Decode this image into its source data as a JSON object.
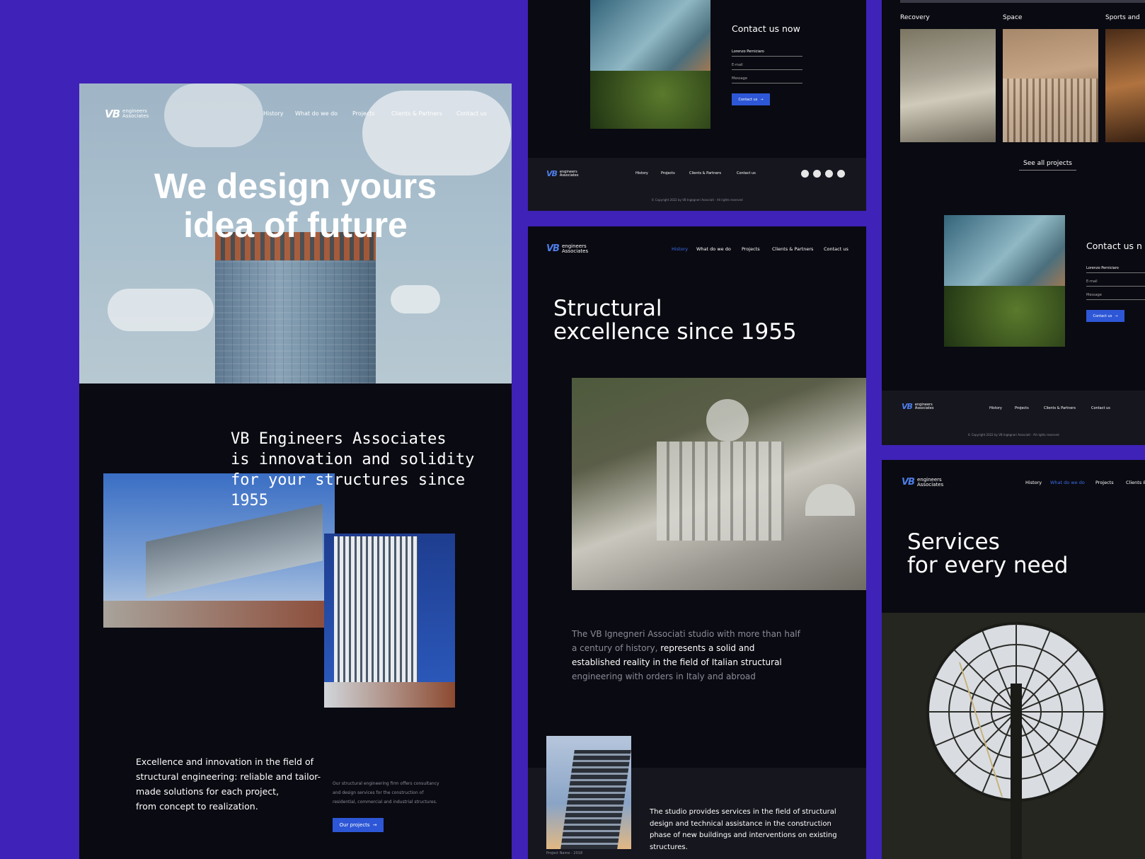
{
  "brand": {
    "mark": "VB",
    "line1": "engineers",
    "line2": "Associates"
  },
  "nav": [
    "History",
    "What do we do",
    "Projects",
    "Clients & Partners",
    "Contact us"
  ],
  "footer_nav": [
    "History",
    "Projects",
    "Clients & Partners",
    "Contact us"
  ],
  "copyright": "© Copyright 2022 by VB Ingegneri Associati - All rights reserved",
  "hero": {
    "title_line1": "We design yours",
    "title_line2": "idea of future"
  },
  "intro": {
    "line1": "VB Engineers Associates",
    "line2": "is innovation and solidity",
    "line3": "for your structures since",
    "line4": "1955"
  },
  "excellence": {
    "line1": "Excellence and innovation in the field of",
    "line2": "structural engineering: reliable and tailor-",
    "line3": "made solutions for each project,",
    "line4": "from concept to realization."
  },
  "small_note": {
    "line1": "Our structural engineering firm offers consultancy",
    "line2": "and design services for the construction of",
    "line3": "residential, commercial and industrial structures."
  },
  "buttons": {
    "projects": "Our projects",
    "contact": "Contact us",
    "arrow": "→"
  },
  "contact": {
    "title": "Contact us now",
    "title_partial": "Contact us n",
    "name_value": "Lorenzo Perniciaro",
    "email_placeholder": "E-mail",
    "message_placeholder": "Message"
  },
  "history": {
    "title_line1": "Structural",
    "title_line2": "excellence since 1955",
    "para_muted1": "The VB Ignegneri Associati studio with more than half",
    "para_muted2": "a century of history,",
    "para_bright2": " represents a solid and",
    "para_bright3": "established reality in the field of Italian structural",
    "para_muted4": "engineering with orders in Italy and abroad",
    "services_l1": "The studio provides services in the field of structural",
    "services_l2": "design and technical assistance in the construction",
    "services_l3": "phase of new buildings and interventions on existing",
    "services_l4": "structures.",
    "caption": "Project Name - 2018"
  },
  "projects": {
    "categories": [
      "Recovery",
      "Space",
      "Sports and"
    ],
    "see_all": "See all projects"
  },
  "services": {
    "title_line1": "Services",
    "title_line2": "for every need"
  },
  "colors": {
    "background": "#3f22b8",
    "panel": "#0a0a12",
    "accent": "#2d57d6",
    "active_nav": "#3a6ee8"
  }
}
